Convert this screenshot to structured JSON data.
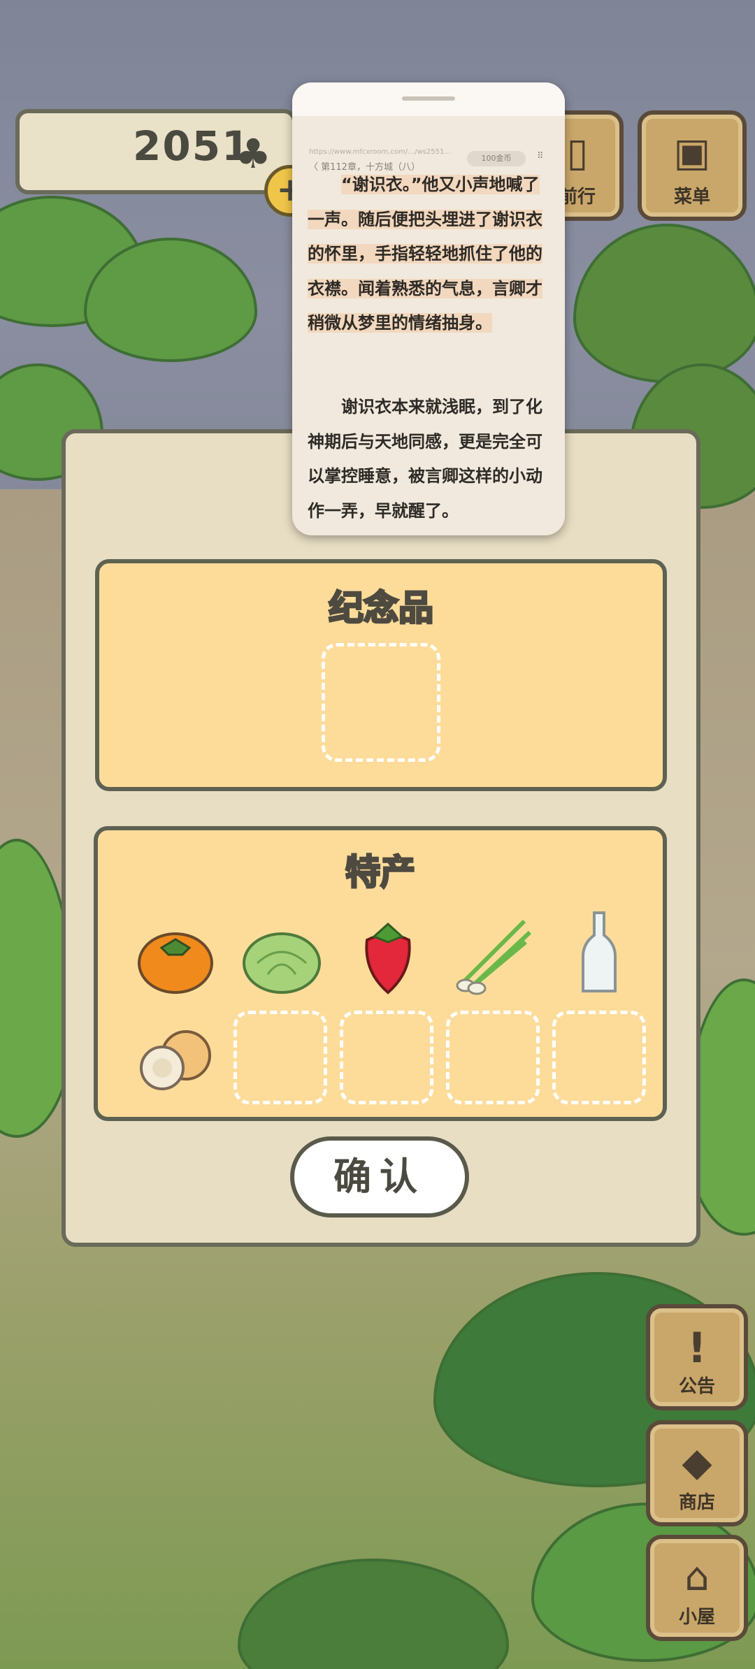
{
  "coins": {
    "count": "2051",
    "clover_icon": "clover-icon",
    "plus_icon": "plus-icon"
  },
  "top_buttons": {
    "travel": {
      "label": "前行",
      "icon": "door-icon"
    },
    "menu": {
      "label": "菜单",
      "icon": "menu-cards-icon"
    }
  },
  "side_buttons": [
    {
      "label": "公告",
      "icon": "exclamation-icon"
    },
    {
      "label": "商店",
      "icon": "shop-bags-icon"
    },
    {
      "label": "小屋",
      "icon": "house-icon"
    }
  ],
  "panel": {
    "souvenir_title": "纪念品",
    "specialty_title": "特产",
    "specialty_items": [
      {
        "name": "persimmon",
        "icon": "persimmon-icon"
      },
      {
        "name": "cabbage",
        "icon": "cabbage-icon"
      },
      {
        "name": "strawberry",
        "icon": "strawberry-icon"
      },
      {
        "name": "green-onion",
        "icon": "green-onion-icon"
      },
      {
        "name": "bottle",
        "icon": "bottle-icon"
      },
      {
        "name": "melon",
        "icon": "melon-icon"
      }
    ],
    "confirm_label": "确认"
  },
  "reader_overlay": {
    "url": "https://www.mfcxroom.com/…/ws2551...",
    "chapter": "〈 第112章，十方城（八）",
    "coins_pill": "100金币",
    "grid_icon": "grid-icon",
    "paragraph1": "“谢识衣。”他又小声地喊了一声。随后便把头埋进了谢识衣的怀里，手指轻轻地抓住了他的衣襟。闻着熟悉的气息，言卿才稍微从梦里的情绪抽身。",
    "paragraph2": "谢识衣本来就浅眠，到了化神期后与天地同感，更是完全可以掌控睡意，被言卿这样的小动作一弄，早就醒了。"
  }
}
